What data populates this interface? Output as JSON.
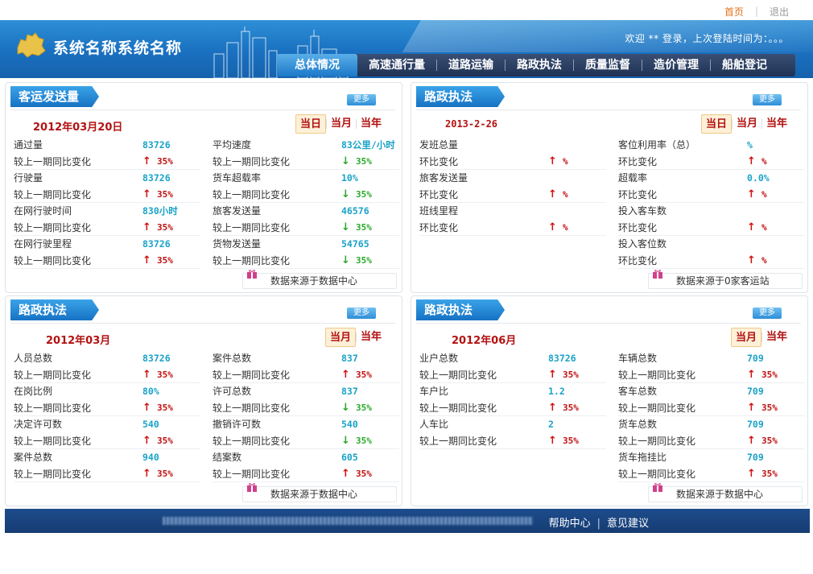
{
  "toplinks": {
    "home": "首页",
    "logout": "退出"
  },
  "header": {
    "title": "系统名称系统名称",
    "welcome": "欢迎 ** 登录，上次登陆时间为：。。。"
  },
  "nav": [
    "总体情况",
    "高速通行量",
    "道路运输",
    "路政执法",
    "质量监督",
    "造价管理",
    "船舶登记"
  ],
  "more_label": "更多",
  "source_label_1": "数据来源于数据中心",
  "source_label_2": "数据来源于0家客运站",
  "panel1": {
    "title": "客运发送量",
    "date": "2012年03月20日",
    "tabs": [
      "当日",
      "当月",
      "当年"
    ],
    "left": [
      {
        "label": "通过量",
        "value": "83726"
      },
      {
        "label": "较上一期同比变化",
        "pct": "35%",
        "dir": "up"
      },
      {
        "label": "行驶量",
        "value": "83726"
      },
      {
        "label": "较上一期同比变化",
        "pct": "35%",
        "dir": "up"
      },
      {
        "label": "在网行驶时间",
        "value": "830小时"
      },
      {
        "label": "较上一期同比变化",
        "pct": "35%",
        "dir": "up"
      },
      {
        "label": "在网行驶里程",
        "value": "83726"
      },
      {
        "label": "较上一期同比变化",
        "pct": "35%",
        "dir": "up"
      }
    ],
    "right": [
      {
        "label": "平均速度",
        "value": "83公里/小时"
      },
      {
        "label": "较上一期同比变化",
        "pct": "35%",
        "dir": "down"
      },
      {
        "label": "货车超载率",
        "value": "10%"
      },
      {
        "label": "较上一期同比变化",
        "pct": "35%",
        "dir": "down"
      },
      {
        "label": "旅客发送量",
        "value": "46576"
      },
      {
        "label": "较上一期同比变化",
        "pct": "35%",
        "dir": "down"
      },
      {
        "label": "货物发送量",
        "value": "54765"
      },
      {
        "label": "较上一期同比变化",
        "pct": "35%",
        "dir": "down"
      }
    ]
  },
  "panel2": {
    "title": "路政执法",
    "date": "2013-2-26",
    "tabs": [
      "当日",
      "当月",
      "当年"
    ],
    "left": [
      {
        "label": "发班总量",
        "value": ""
      },
      {
        "label": "环比变化",
        "pct": "%",
        "dir": "up"
      },
      {
        "label": "旅客发送量",
        "value": ""
      },
      {
        "label": "环比变化",
        "pct": "%",
        "dir": "up"
      },
      {
        "label": "班线里程",
        "value": ""
      },
      {
        "label": "环比变化",
        "pct": "%",
        "dir": "up"
      }
    ],
    "right": [
      {
        "label": "客位利用率（总）",
        "value": "%"
      },
      {
        "label": "环比变化",
        "pct": "%",
        "dir": "up"
      },
      {
        "label": "超载率",
        "value": "0.0%"
      },
      {
        "label": "环比变化",
        "pct": "%",
        "dir": "up"
      },
      {
        "label": "投入客车数",
        "value": ""
      },
      {
        "label": "环比变化",
        "pct": "%",
        "dir": "up"
      },
      {
        "label": "投入客位数",
        "value": ""
      },
      {
        "label": "环比变化",
        "pct": "%",
        "dir": "up"
      }
    ]
  },
  "panel3": {
    "title": "路政执法",
    "date": "2012年03月",
    "tabs": [
      "当月",
      "当年"
    ],
    "left": [
      {
        "label": "人员总数",
        "value": "83726"
      },
      {
        "label": "较上一期同比变化",
        "pct": "35%",
        "dir": "up"
      },
      {
        "label": "在岗比例",
        "value": "80%"
      },
      {
        "label": "较上一期同比变化",
        "pct": "35%",
        "dir": "up"
      },
      {
        "label": "决定许可数",
        "value": "540"
      },
      {
        "label": "较上一期同比变化",
        "pct": "35%",
        "dir": "up"
      },
      {
        "label": "案件总数",
        "value": "940"
      },
      {
        "label": "较上一期同比变化",
        "pct": "35%",
        "dir": "up"
      }
    ],
    "right": [
      {
        "label": "案件总数",
        "value": "837"
      },
      {
        "label": "较上一期同比变化",
        "pct": "35%",
        "dir": "up"
      },
      {
        "label": "许可总数",
        "value": "837"
      },
      {
        "label": "较上一期同比变化",
        "pct": "35%",
        "dir": "down"
      },
      {
        "label": "撤销许可数",
        "value": "540"
      },
      {
        "label": "较上一期同比变化",
        "pct": "35%",
        "dir": "down"
      },
      {
        "label": "结案数",
        "value": "605"
      },
      {
        "label": "较上一期同比变化",
        "pct": "35%",
        "dir": "up"
      }
    ]
  },
  "panel4": {
    "title": "路政执法",
    "date": "2012年06月",
    "tabs": [
      "当月",
      "当年"
    ],
    "left": [
      {
        "label": "业户总数",
        "value": "83726"
      },
      {
        "label": "较上一期同比变化",
        "pct": "35%",
        "dir": "up"
      },
      {
        "label": "车户比",
        "value": "1.2"
      },
      {
        "label": "较上一期同比变化",
        "pct": "35%",
        "dir": "up"
      },
      {
        "label": "人车比",
        "value": "2"
      },
      {
        "label": "较上一期同比变化",
        "pct": "35%",
        "dir": "up"
      }
    ],
    "right": [
      {
        "label": "车辆总数",
        "value": "709"
      },
      {
        "label": "较上一期同比变化",
        "pct": "35%",
        "dir": "up"
      },
      {
        "label": "客车总数",
        "value": "709"
      },
      {
        "label": "较上一期同比变化",
        "pct": "35%",
        "dir": "up"
      },
      {
        "label": "货车总数",
        "value": "709"
      },
      {
        "label": "较上一期同比变化",
        "pct": "35%",
        "dir": "up"
      },
      {
        "label": "货车拖挂比",
        "value": "709"
      },
      {
        "label": "较上一期同比变化",
        "pct": "35%",
        "dir": "up"
      }
    ]
  },
  "footer": {
    "help": "帮助中心",
    "feedback": "意见建议"
  }
}
